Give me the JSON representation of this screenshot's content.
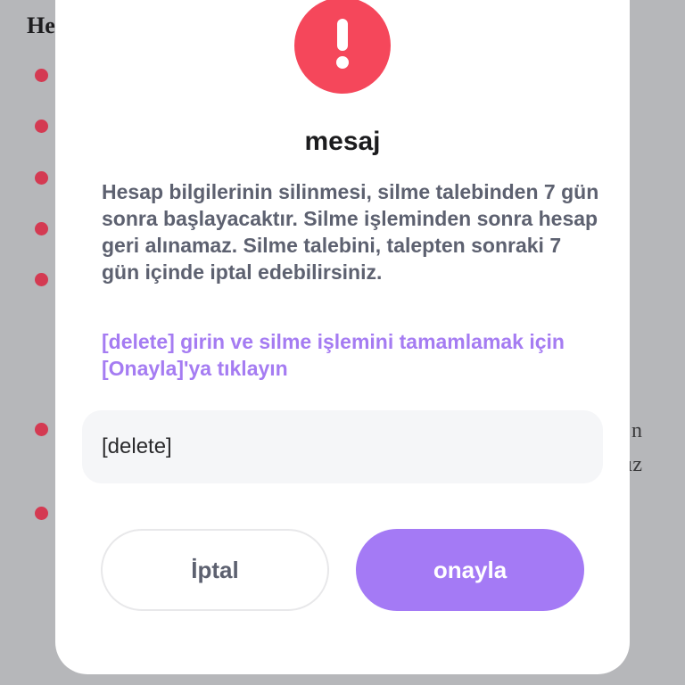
{
  "background": {
    "heading_fragment": "He",
    "right_text_1": "n",
    "right_text_2": "ız",
    "bullet_color": "#d43a52"
  },
  "dialog": {
    "icon": "exclamation-icon",
    "icon_color": "#f5475b",
    "title": "mesaj",
    "message": "Hesap bilgilerinin silinmesi, silme talebinden 7 gün sonra başlayacaktır. Silme işleminden sonra hesap geri alınamaz. Silme talebini, talepten sonraki 7 gün içinde iptal edebilirsiniz.",
    "hint": "[delete] girin ve silme işlemini tamamlamak için [Onayla]'ya tıklayın",
    "hint_color": "#a57cf2",
    "input_value": "[delete]",
    "cancel_label": "İptal",
    "confirm_label": "onayla",
    "accent_color": "#a47af5"
  }
}
